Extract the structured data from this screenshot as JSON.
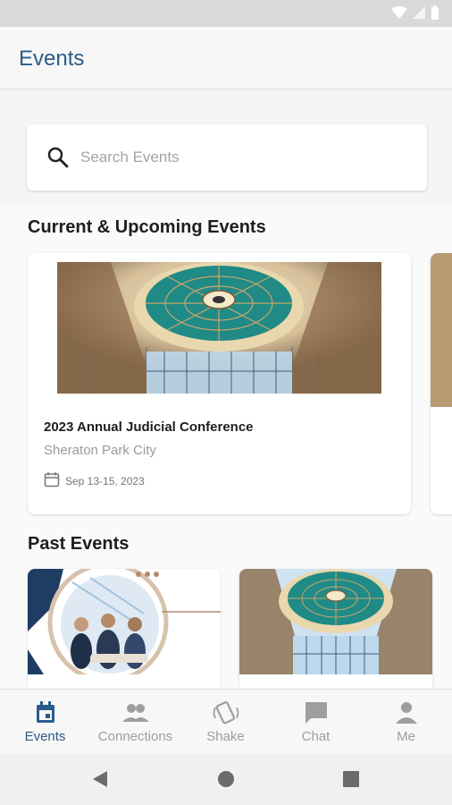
{
  "app": {
    "title": "Events"
  },
  "search": {
    "placeholder": "Search Events",
    "value": ""
  },
  "sections": {
    "current": "Current & Upcoming Events",
    "past": "Past Events"
  },
  "current_events": [
    {
      "title": "2023 Annual Judicial Conference",
      "location": "Sheraton Park City",
      "date": "Sep 13-15, 2023",
      "image": "dome-interior"
    }
  ],
  "past_events": [
    {
      "image": "business-meeting"
    },
    {
      "image": "dome-interior"
    }
  ],
  "tabs": [
    {
      "label": "Events",
      "icon": "calendar-icon",
      "active": true
    },
    {
      "label": "Connections",
      "icon": "people-icon",
      "active": false
    },
    {
      "label": "Shake",
      "icon": "shake-icon",
      "active": false
    },
    {
      "label": "Chat",
      "icon": "chat-icon",
      "active": false
    },
    {
      "label": "Me",
      "icon": "person-icon",
      "active": false
    }
  ],
  "colors": {
    "accent": "#2b5c8a",
    "inactive": "#9e9e9e",
    "dome_teal": "#1f8a86"
  }
}
